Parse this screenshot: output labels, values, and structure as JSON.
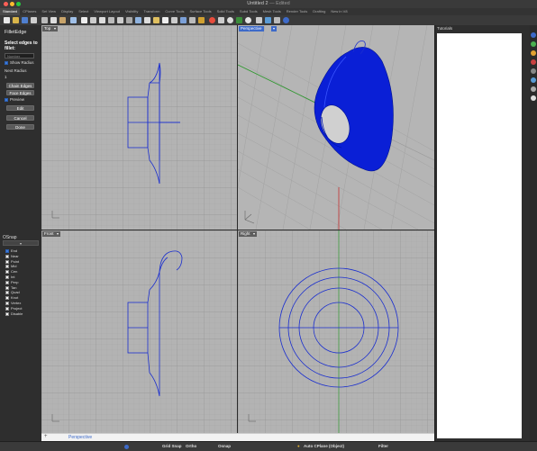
{
  "window": {
    "title": "Untitled 2",
    "separator": "—",
    "subtitle": "Edited"
  },
  "tabs": [
    "Standard",
    "CPlanes",
    "Set View",
    "Display",
    "Select",
    "Viewport Layout",
    "Visibility",
    "Transform",
    "Curve Tools",
    "Surface Tools",
    "Solid Tools",
    "Subd Tools",
    "Mesh Tools",
    "Render Tools",
    "Drafting",
    "New in V8"
  ],
  "left_panel": {
    "title": "FilletEdge",
    "prompt": "Select edges to fillet:",
    "number_placeholder": "Number",
    "show_radius": "Show Radius",
    "next_radius_label": "Next Radius",
    "next_radius_value": "1",
    "chain_edges": "Chain Edges",
    "face_edges": "Face Edges",
    "preview": "Preview",
    "edit": "Edit",
    "cancel": "Cancel",
    "done": "Done"
  },
  "osnap": {
    "title": "OSnap",
    "items": [
      "End",
      "Near",
      "Point",
      "Mid",
      "Cen",
      "Int",
      "Perp",
      "Tan",
      "Quad",
      "Knot",
      "Vertex",
      "Project"
    ],
    "checked": [
      true,
      false,
      false,
      false,
      false,
      false,
      false,
      false,
      false,
      false,
      false,
      false
    ],
    "disable": "Disable"
  },
  "viewports": {
    "top": "Top",
    "perspective": "Perspective",
    "front": "Front",
    "right": "Right"
  },
  "right_panel": {
    "title": "Tutorials"
  },
  "bottom_tabs": {
    "active": "Perspective"
  },
  "status": {
    "grid_snap": "Grid Snap",
    "ortho": "Ortho",
    "osnap": "Osnap",
    "cplane": "Auto CPlane (Object)",
    "filter": "Filter"
  },
  "colors": {
    "curve": "#1a2ecf",
    "surface": "#0a1fd6",
    "accent": "#3d6ac9"
  }
}
